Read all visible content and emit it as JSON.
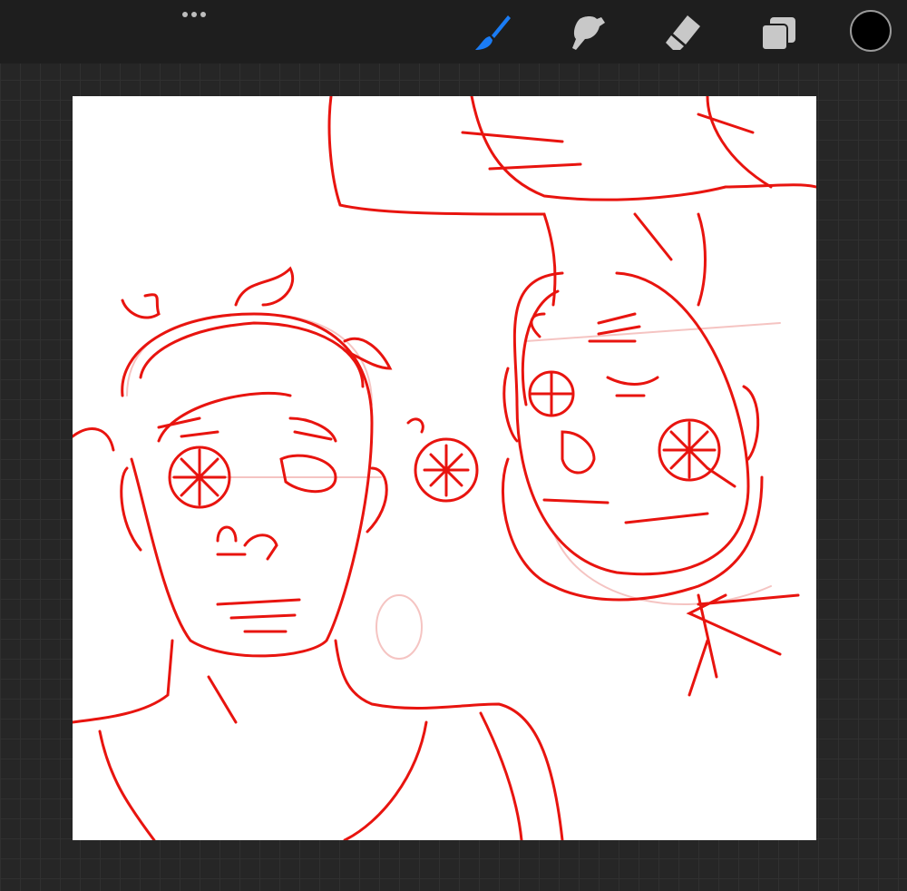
{
  "toolbar": {
    "more_icon": "ellipsis-icon",
    "tools": [
      {
        "name": "brush",
        "icon": "brush-icon",
        "active": true
      },
      {
        "name": "smudge",
        "icon": "smudge-finger-icon",
        "active": false
      },
      {
        "name": "eraser",
        "icon": "eraser-icon",
        "active": false
      },
      {
        "name": "layers",
        "icon": "layers-icon",
        "active": false
      }
    ],
    "current_color": "#000000"
  },
  "colors": {
    "active_tool": "#1a7cf5",
    "inactive_tool": "#c8c8c8",
    "stroke": "#e8140f",
    "stroke_light": "#f5c4c2"
  }
}
